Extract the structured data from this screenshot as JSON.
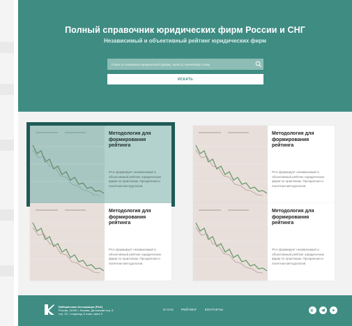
{
  "hero": {
    "title": "Полный справочник юридических фирм России и СНГ",
    "subtitle": "Независимый и объективный рейтинг юридических фирм"
  },
  "search": {
    "placeholder": "Поиск по названию юридической фирмы, юристу, ключевому слову",
    "button_label": "ИСКАТЬ"
  },
  "cards": [
    {
      "title": "Методология для формирования рейтинга",
      "description": "РАА формирует независимый и объективный рейтинг юридических фирм по практикам. Прозрачная и понятная методология."
    },
    {
      "title": "Методология для формирования рейтинга",
      "description": "РАА формирует независимый и объективный рейтинг юридических фирм по практикам. Прозрачная и понятная методология."
    },
    {
      "title": "Методология для формирования рейтинга",
      "description": "РАА формирует независимый и объективный рейтинг юридических фирм по практикам. Прозрачная и понятная методология."
    },
    {
      "title": "Методология для формирования рейтинга",
      "description": "РАА формирует независимый и объективный рейтинг юридических фирм по практикам. Прозрачная и понятная методология."
    }
  ],
  "footer": {
    "company_name": "Байтранском Ассоциация (РАА)",
    "address_line1": "Россия, 11000 г. Москва, Даловский пер. 8",
    "address_line2": "стр. 15, 1 подъезд, 6 этаж, офис 9",
    "nav": [
      "О НАС",
      "РЕЙТИНГ",
      "КОНТАКТЫ"
    ],
    "social_icons": [
      "vk-icon",
      "telegram-icon",
      "youtube-icon"
    ]
  },
  "colors": {
    "brand": "#3f8c83",
    "active_outline": "#1f5a56"
  }
}
